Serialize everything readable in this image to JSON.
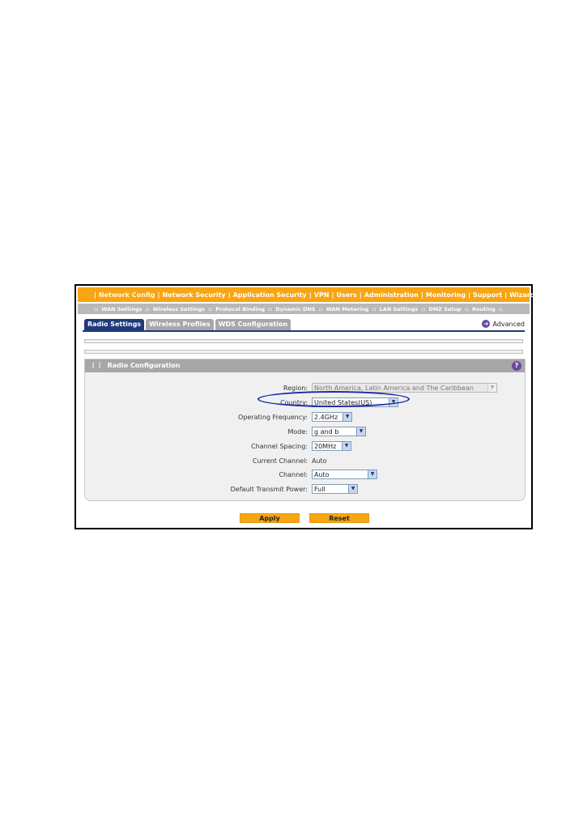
{
  "main_nav": [
    "Network Config",
    "Network Security",
    "Application Security",
    "VPN",
    "Users",
    "Administration",
    "Monitoring",
    "Support",
    "Wizards"
  ],
  "sub_nav": [
    "WAN Settings",
    "Wireless Settings",
    "Protocol Binding",
    "Dynamic DNS",
    "WAN Metering",
    "LAN Settings",
    "DMZ Setup",
    "Routing"
  ],
  "tabs": [
    "Radio Settings",
    "Wireless Profiles",
    "WDS Configuration"
  ],
  "advanced_label": "Advanced",
  "panel": {
    "title": "Radio Configuration",
    "fields": {
      "region": {
        "label": "Region:",
        "value": "North America, Latin America and The Caribbean"
      },
      "country": {
        "label": "Country:",
        "value": "United States(US)"
      },
      "frequency": {
        "label": "Operating Frequency:",
        "value": "2.4GHz"
      },
      "mode": {
        "label": "Mode:",
        "value": "g and b"
      },
      "spacing": {
        "label": "Channel Spacing:",
        "value": "20MHz"
      },
      "current_channel": {
        "label": "Current Channel:",
        "value": "Auto"
      },
      "channel": {
        "label": "Channel:",
        "value": "Auto"
      },
      "power": {
        "label": "Default Transmit Power:",
        "value": "Full"
      }
    }
  },
  "buttons": {
    "apply": "Apply",
    "reset": "Reset"
  },
  "colors": {
    "accent": "#f7a512",
    "tab_active": "#1f3a7a",
    "highlight": "#1a2aa8"
  }
}
